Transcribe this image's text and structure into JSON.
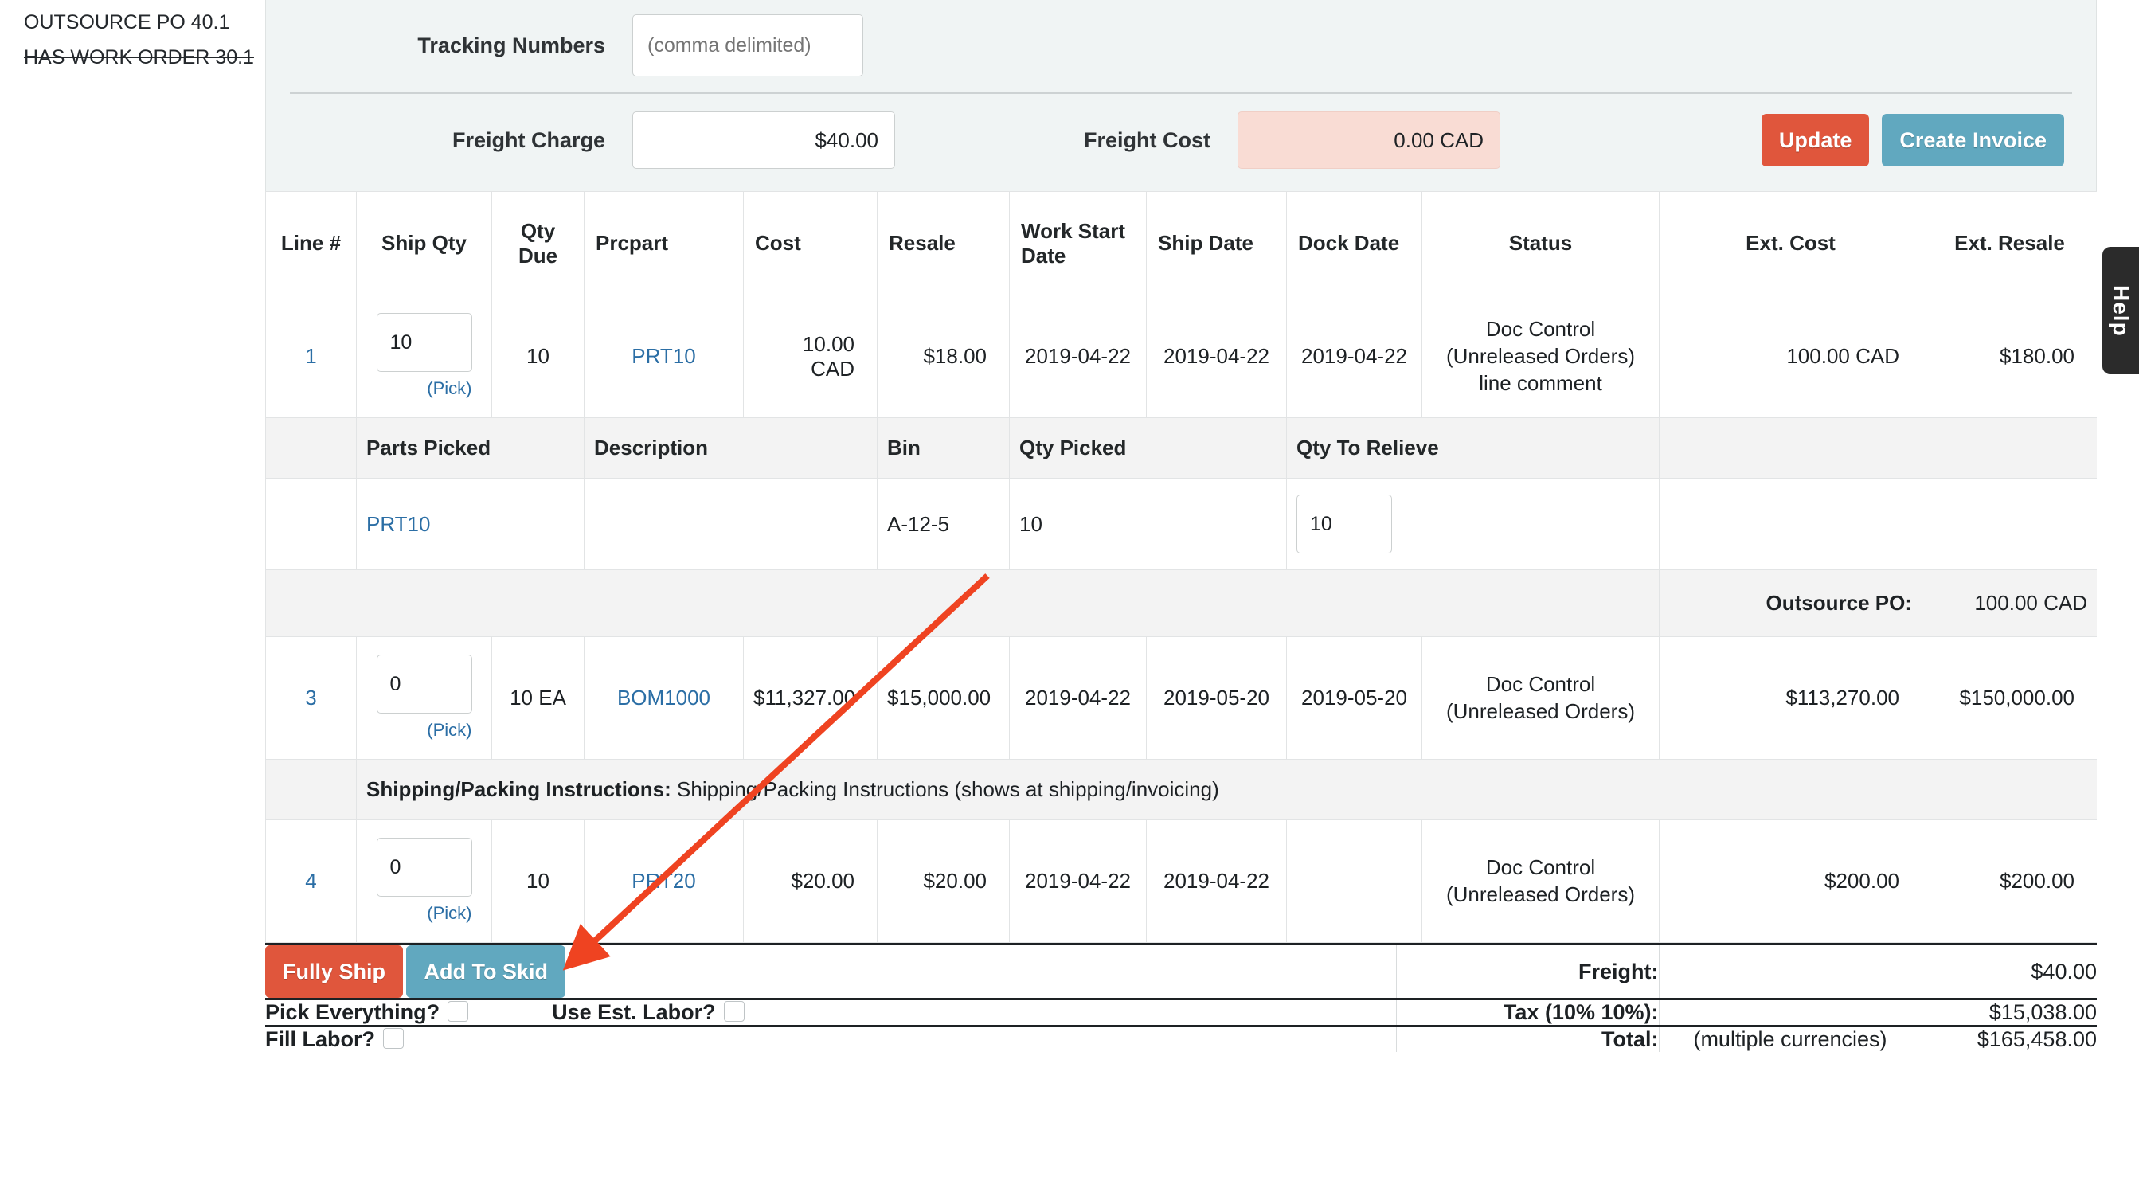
{
  "sidebar": {
    "lines": [
      {
        "text": "OUTSOURCE PO 40.1",
        "struck": false
      },
      {
        "text": "HAS WORK ORDER 30.1",
        "struck": true
      }
    ]
  },
  "header": {
    "tracking_label": "Tracking Numbers",
    "tracking_value": "",
    "tracking_placeholder": "(comma delimited)",
    "freight_charge_label": "Freight Charge",
    "freight_charge_value": "$40.00",
    "freight_cost_label": "Freight Cost",
    "freight_cost_value": "0.00 CAD",
    "update_label": "Update",
    "create_invoice_label": "Create Invoice"
  },
  "help_tab": {
    "label": "Help"
  },
  "table": {
    "columns": [
      "Line #",
      "Ship Qty",
      "Qty Due",
      "Prcpart",
      "Cost",
      "Resale",
      "Work Start Date",
      "Ship Date",
      "Dock Date",
      "Status",
      "Ext. Cost",
      "Ext. Resale"
    ],
    "pick_label": "(Pick)",
    "rows": [
      {
        "line": "1",
        "ship_qty": "10",
        "qty_due": "10",
        "prcpart": "PRT10",
        "cost": "10.00 CAD",
        "resale": "$18.00",
        "work_start_date": "2019-04-22",
        "ship_date": "2019-04-22",
        "dock_date": "2019-04-22",
        "status_line1": "Doc Control",
        "status_line2": "(Unreleased Orders)",
        "status_line3": "line comment",
        "ext_cost": "100.00 CAD",
        "ext_resale": "$180.00"
      },
      {
        "line": "3",
        "ship_qty": "0",
        "qty_due": "10 EA",
        "prcpart": "BOM1000",
        "cost": "$11,327.00",
        "resale": "$15,000.00",
        "work_start_date": "2019-04-22",
        "ship_date": "2019-05-20",
        "dock_date": "2019-05-20",
        "status_line1": "Doc Control",
        "status_line2": "(Unreleased Orders)",
        "status_line3": "",
        "ext_cost": "$113,270.00",
        "ext_resale": "$150,000.00"
      },
      {
        "line": "4",
        "ship_qty": "0",
        "qty_due": "10",
        "prcpart": "PRT20",
        "cost": "$20.00",
        "resale": "$20.00",
        "work_start_date": "2019-04-22",
        "ship_date": "2019-04-22",
        "dock_date": "",
        "status_line1": "Doc Control",
        "status_line2": "(Unreleased Orders)",
        "status_line3": "",
        "ext_cost": "$200.00",
        "ext_resale": "$200.00"
      }
    ],
    "picked_section": {
      "columns": [
        "Parts Picked",
        "Description",
        "Bin",
        "Qty Picked",
        "Qty To Relieve"
      ],
      "row": {
        "part": "PRT10",
        "description": "",
        "bin": "A-12-5",
        "qty_picked": "10",
        "qty_to_relieve": "10"
      }
    },
    "outsource_po": {
      "label": "Outsource PO:",
      "value": "100.00 CAD"
    },
    "instructions": {
      "label": "Shipping/Packing Instructions:",
      "text": "Shipping/Packing Instructions (shows at shipping/invoicing)"
    }
  },
  "footer": {
    "fully_ship_label": "Fully Ship",
    "add_to_skid_label": "Add To Skid",
    "pick_everything_label": "Pick Everything?",
    "use_est_labor_label": "Use Est. Labor?",
    "fill_labor_label": "Fill Labor?",
    "freight_label": "Freight:",
    "freight_value": "$40.00",
    "tax_label": "Tax (10% 10%):",
    "tax_value": "$15,038.00",
    "total_label": "Total:",
    "total_mid": "(multiple currencies)",
    "total_value": "$165,458.00"
  },
  "colors": {
    "orange": "#e0563c",
    "blue": "#61a8bf",
    "link": "#2b6ea5",
    "header_underline": "#286090",
    "panel_bg": "#f0f4f4",
    "cost_bg": "#f9dcd4",
    "annotation": "#ef4321"
  }
}
